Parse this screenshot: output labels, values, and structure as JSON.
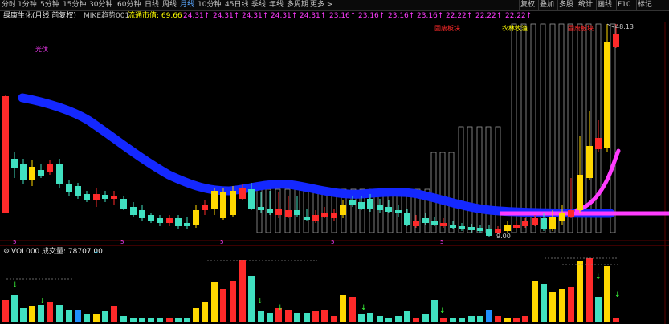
{
  "toolbar": {
    "tabs": [
      "分时",
      "1分钟",
      "5分钟",
      "15分钟",
      "30分钟",
      "60分钟",
      "日线",
      "周线",
      "月线",
      "10分钟",
      "45日线",
      "季线",
      "年线",
      "多周期",
      "更多 >"
    ],
    "active": "月线",
    "right_buttons": [
      "复权",
      "叠加",
      "多股",
      "统计",
      "画线",
      "F10",
      "标记"
    ]
  },
  "infobar": {
    "stock_name": "绿康生化(月线 前复权)",
    "indicator": "MIKE趋势001",
    "market_value_label": "流通市值: 69.66",
    "markers": [
      {
        "text": "24.31↑",
        "color": "mag"
      },
      {
        "text": "24.31↑",
        "color": "mag"
      },
      {
        "text": "24.31↑",
        "color": "mag"
      },
      {
        "text": "24.31↑",
        "color": "mag"
      },
      {
        "text": "24.31↑",
        "color": "mag"
      },
      {
        "text": "23.16↑",
        "color": "mag"
      },
      {
        "text": "23.16↑",
        "color": "mag"
      },
      {
        "text": "23.16↑",
        "color": "mag"
      },
      {
        "text": "23.16↑",
        "color": "mag"
      },
      {
        "text": "22.22↑",
        "color": "mag"
      },
      {
        "text": "22.22↑",
        "color": "mag"
      },
      {
        "text": "22.22↑",
        "color": "mag"
      }
    ]
  },
  "chart": {
    "annotations": [
      {
        "text": "光伏",
        "color": "#ff3cff"
      },
      {
        "text": "固废板块",
        "color": "#ff2a2a"
      },
      {
        "text": "农林牧渔",
        "color": "#ffff00"
      },
      {
        "text": "固废板块",
        "color": "#ff2a2a"
      }
    ],
    "high_label": "48.13",
    "low_label": "9.00",
    "period_markers": [
      "5",
      "5",
      "5",
      "5",
      "5"
    ]
  },
  "volume": {
    "label": "VOL000",
    "value_label": "成交量: 78707.00",
    "arrow": "↓"
  },
  "colors": {
    "up": "#ff2a2a",
    "down": "#40e0c0",
    "yellow": "#ffd700",
    "blue_band": "#1428ff",
    "magenta_line": "#ff3cff"
  },
  "chart_data": {
    "type": "candlestick",
    "high": 48.13,
    "low": 9.0
  }
}
